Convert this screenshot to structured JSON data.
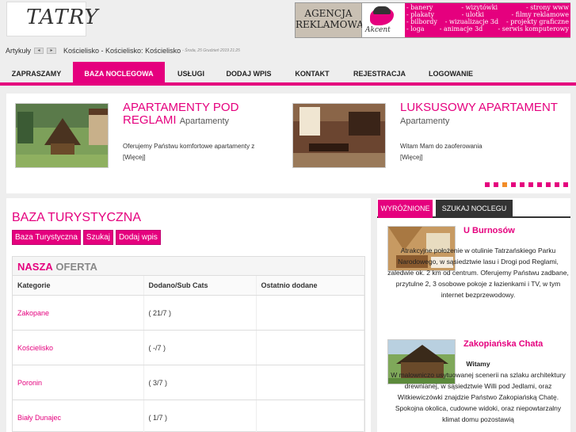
{
  "logo": {
    "text": "TATRY"
  },
  "ad": {
    "left_lines": [
      "AGENCJA",
      "REKLAMOWA"
    ],
    "brand": "Akcent",
    "rows": [
      [
        "- banery",
        "- wizytówki",
        "- strony  www"
      ],
      [
        "- plakaty",
        "- ulotki",
        "- filmy reklamowe"
      ],
      [
        "- bilbordy",
        "- wizualizacje 3d",
        "- projekty graficzne"
      ],
      [
        "- loga",
        "- animacje 3d",
        "- serwis komputerowy"
      ]
    ]
  },
  "breadcrumb": {
    "root": "Artykuły",
    "arrow_left": "◂",
    "arrow_right": "▸",
    "path": "Kościelisko - Kościelisko:",
    "current": "Kościelisko",
    "date": "- Środa, 25 Grudzień 2019 21:25"
  },
  "nav": [
    "ZAPRASZAMY",
    "BAZA NOCLEGOWA",
    "USŁUGI",
    "DODAJ WPIS",
    "KONTAKT",
    "REJESTRACJA",
    "LOGOWANIE"
  ],
  "nav_active": "BAZA NOCLEGOWA",
  "slides": [
    {
      "title": "APARTAMENTY POD REGLAMI",
      "category": "Apartamenty",
      "desc": "Oferujemy Państwu komfortowe apartamenty z",
      "more": "[Więcej]"
    },
    {
      "title": "LUKSUSOWY APARTAMENT",
      "category": "Apartamenty",
      "desc": "Witam Mam do zaoferowania",
      "more": "[Więcej]"
    }
  ],
  "slider_dots": 10,
  "slider_active_dot": 2,
  "main": {
    "title": "BAZA TURYSTYCZNA",
    "buttons": [
      "Baza Turystyczna",
      "Szukaj",
      "Dodaj wpis"
    ],
    "offer_bold": "NASZA",
    "offer_rest": "OFERTA",
    "columns": [
      "Kategorie",
      "Dodano/Sub Cats",
      "Ostatnio dodane"
    ],
    "rows": [
      {
        "cat": "Zakopane",
        "count": "( 21/7 )",
        "last": ""
      },
      {
        "cat": "Kościelisko",
        "count": "( -/7 )",
        "last": ""
      },
      {
        "cat": "Poronin",
        "count": "( 3/7 )",
        "last": ""
      },
      {
        "cat": "Biały Dunajec",
        "count": "( 1/7 )",
        "last": ""
      }
    ]
  },
  "side": {
    "tabs": [
      "WYRÓŻNIONE",
      "SZUKAJ NOCLEGU"
    ],
    "items": [
      {
        "title": "U Burnosów",
        "text": "Atrakcyjne położenie w otulinie Tatrzańskiego Parku Narodowego, w sąsiedztwie lasu i Drogi pod Reglami, zaledwie ok. 2 km od centrum. Oferujemy Państwu zadbane, przytulne 2, 3 osobowe pokoje z łazienkami i TV, w tym internet bezprzewodowy."
      },
      {
        "title": "Zakopiańska Chata",
        "lead": "Witamy",
        "text": "W malowniczo usytuowanej scenerii na szlaku architektury drewnianej, w sąsiedztwie Willi pod Jedlami, oraz Witkiewiczówki znajdzie Państwo Zakopiańską Chatę. Spokojna okolica, cudowne widoki, oraz niepowtarzalny klimat domu pozostawią"
      }
    ]
  },
  "colors": {
    "accent": "#e5007e",
    "bg": "#eeeeee",
    "active_dot": "#f28c28"
  }
}
